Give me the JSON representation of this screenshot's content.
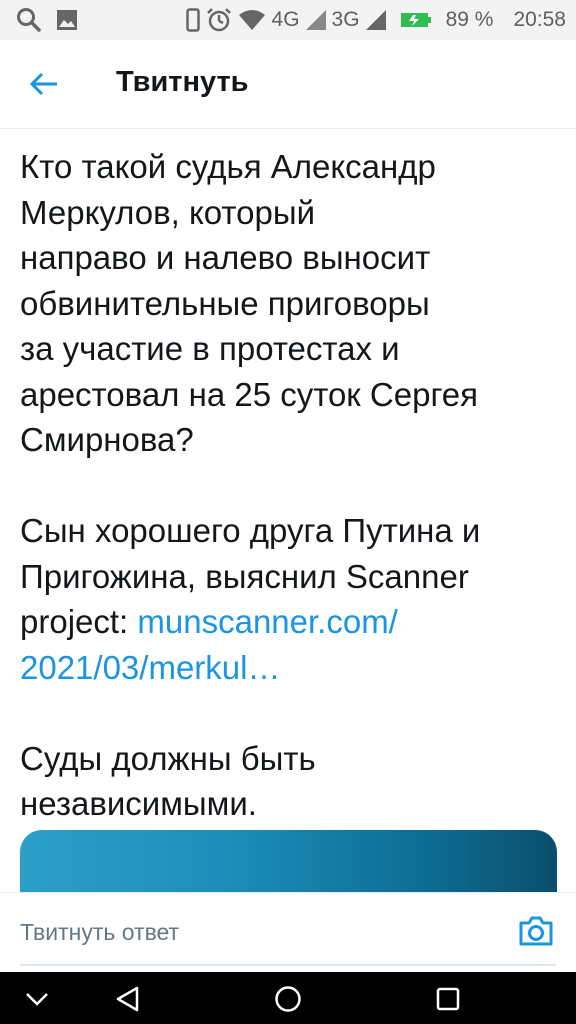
{
  "status_bar": {
    "network_4g": "4G",
    "network_3g": "3G",
    "battery_percent": "89 %",
    "time": "20:58",
    "icons": [
      "search-icon",
      "image-icon",
      "phone-icon",
      "alarm-icon",
      "wifi-icon",
      "signal-icon",
      "battery-icon"
    ]
  },
  "header": {
    "title": "Твитнуть",
    "back_icon": "arrow-left-icon"
  },
  "tweet": {
    "paragraph1_lines": [
      "Кто такой судья Александр",
      "Меркулов, который",
      "направо и налево выносит",
      "обвинительные приговоры",
      "за участие в протестах и",
      "арестовал на 25 суток Сергея",
      "Смирнова?"
    ],
    "paragraph2_lines": [
      "Сын хорошего друга Путина и",
      "Пригожина, выяснил Scanner"
    ],
    "paragraph2_prefix": "project: ",
    "link_line1": "munscanner.com/",
    "link_line2": "2021/03/merkul…",
    "paragraph3_lines": [
      "Суды должны быть",
      "независимыми."
    ]
  },
  "reply": {
    "placeholder": "Твитнуть ответ",
    "camera_icon": "camera-icon"
  },
  "nav_bar": {
    "icons": [
      "chevron-down-icon",
      "back-triangle-icon",
      "home-circle-icon",
      "recents-square-icon"
    ]
  },
  "colors": {
    "accent": "#1b95e0",
    "text": "#14171a",
    "muted": "#657786"
  }
}
